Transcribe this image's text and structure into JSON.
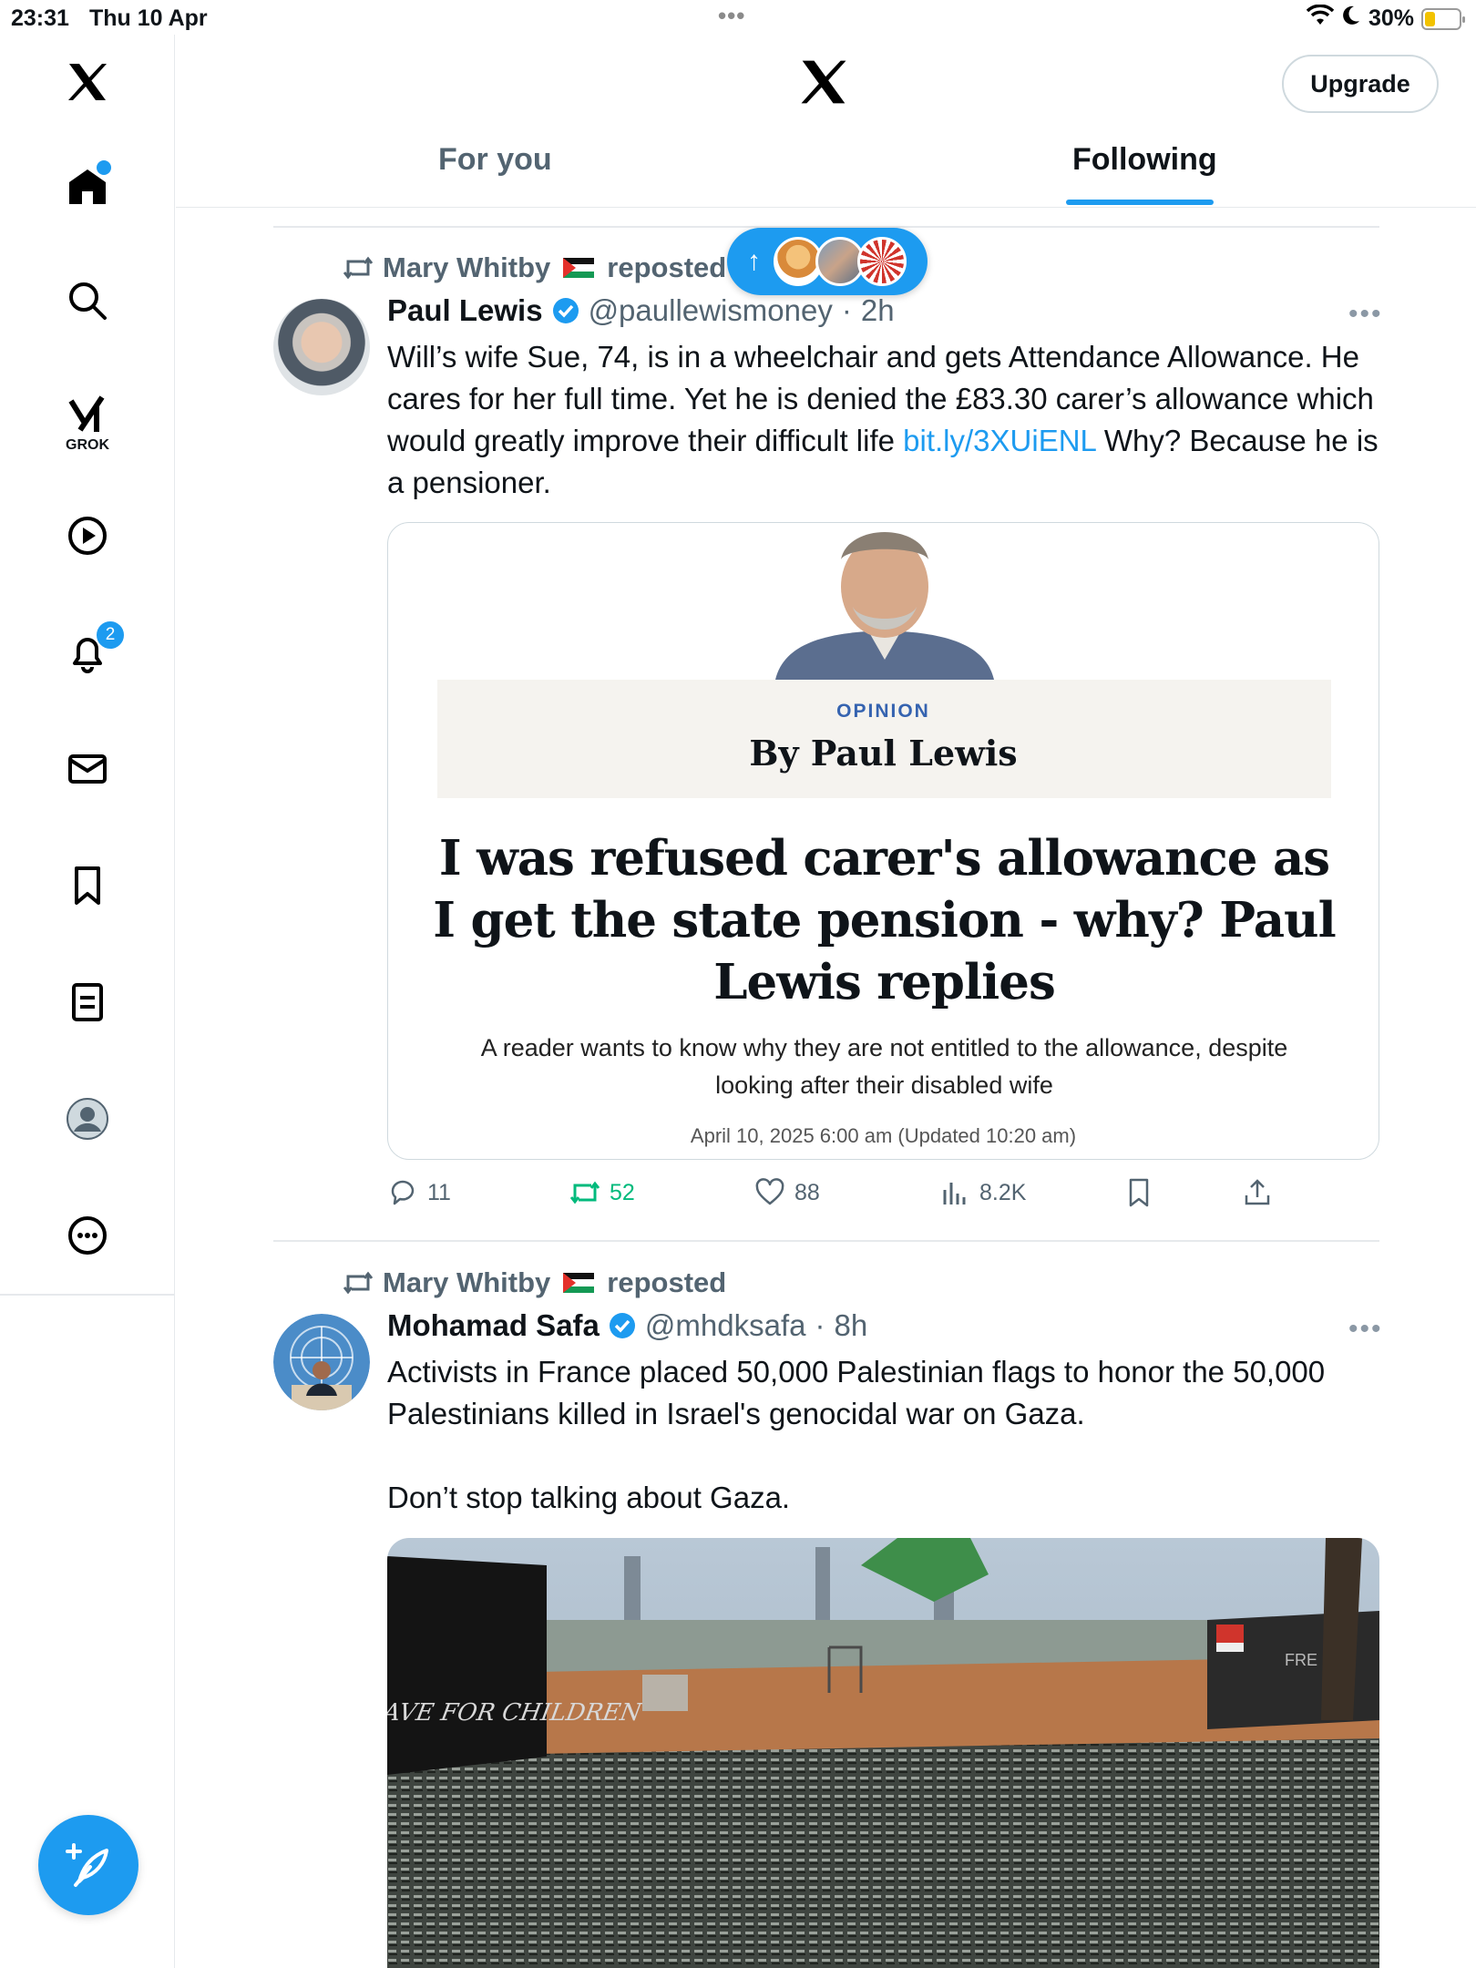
{
  "status_bar": {
    "time": "23:31",
    "date": "Thu 10 Apr",
    "battery_text": "30%",
    "battery_level": 0.3,
    "icons": [
      "wifi-icon",
      "moon-icon",
      "battery-icon"
    ]
  },
  "sidebar": {
    "grok_label": "GROK",
    "notifications_badge": "2",
    "items": [
      "x-logo-icon",
      "home-icon",
      "search-icon",
      "grok-icon",
      "play-icon",
      "bell-icon",
      "mail-icon",
      "bookmark-icon",
      "list-icon",
      "profile-icon",
      "more-circle-icon"
    ]
  },
  "header": {
    "upgrade_label": "Upgrade",
    "tabs": [
      {
        "label": "For you",
        "active": false
      },
      {
        "label": "Following",
        "active": true
      }
    ]
  },
  "new_posts_pill": {
    "arrow": "↑"
  },
  "tweets": [
    {
      "repost_by": "Mary Whitby",
      "repost_label": "reposted",
      "name": "Paul Lewis",
      "handle": "@paullewismoney",
      "dot": "·",
      "time": "2h",
      "more": "•••",
      "text_before_link": "Will’s wife Sue, 74, is in a wheelchair and gets Attendance Allowance. He cares for her full time. Yet he is denied the £83.30 carer’s allowance which would greatly improve their difficult life ",
      "link": "bit.ly/3XUiENL",
      "text_after_link": " Why? Because he is a pensioner.",
      "card": {
        "kicker": "OPINION",
        "byline": "By Paul Lewis",
        "headline": "I was refused carer's allowance as I get the state pension - why? Paul Lewis replies",
        "standfirst": "A reader wants to know why they are not entitled to the allowance, despite looking after their disabled wife",
        "dateline": "April 10, 2025 6:00 am (Updated 10:20 am)"
      },
      "stats": {
        "replies": "11",
        "reposts": "52",
        "likes": "88",
        "views": "8.2K"
      }
    },
    {
      "repost_by": "Mary Whitby",
      "repost_label": "reposted",
      "name": "Mohamad Safa",
      "handle": "@mhdksafa",
      "dot": "·",
      "time": "8h",
      "more": "•••",
      "text_line1": "Activists in France placed 50,000 Palestinian flags to honor the 50,000 Palestinians killed in Israel's genocidal war on Gaza.",
      "text_line2": "Don’t stop talking about Gaza.",
      "video_sign_text": "RAVE FOR CHILDREN",
      "video_sign_text2": "FRE"
    }
  ],
  "colors": {
    "accent": "#1d9bf0",
    "text_primary": "#0f1419",
    "text_secondary": "#536471",
    "repost_green": "#00ba7c",
    "divider": "#e6e9ec"
  }
}
